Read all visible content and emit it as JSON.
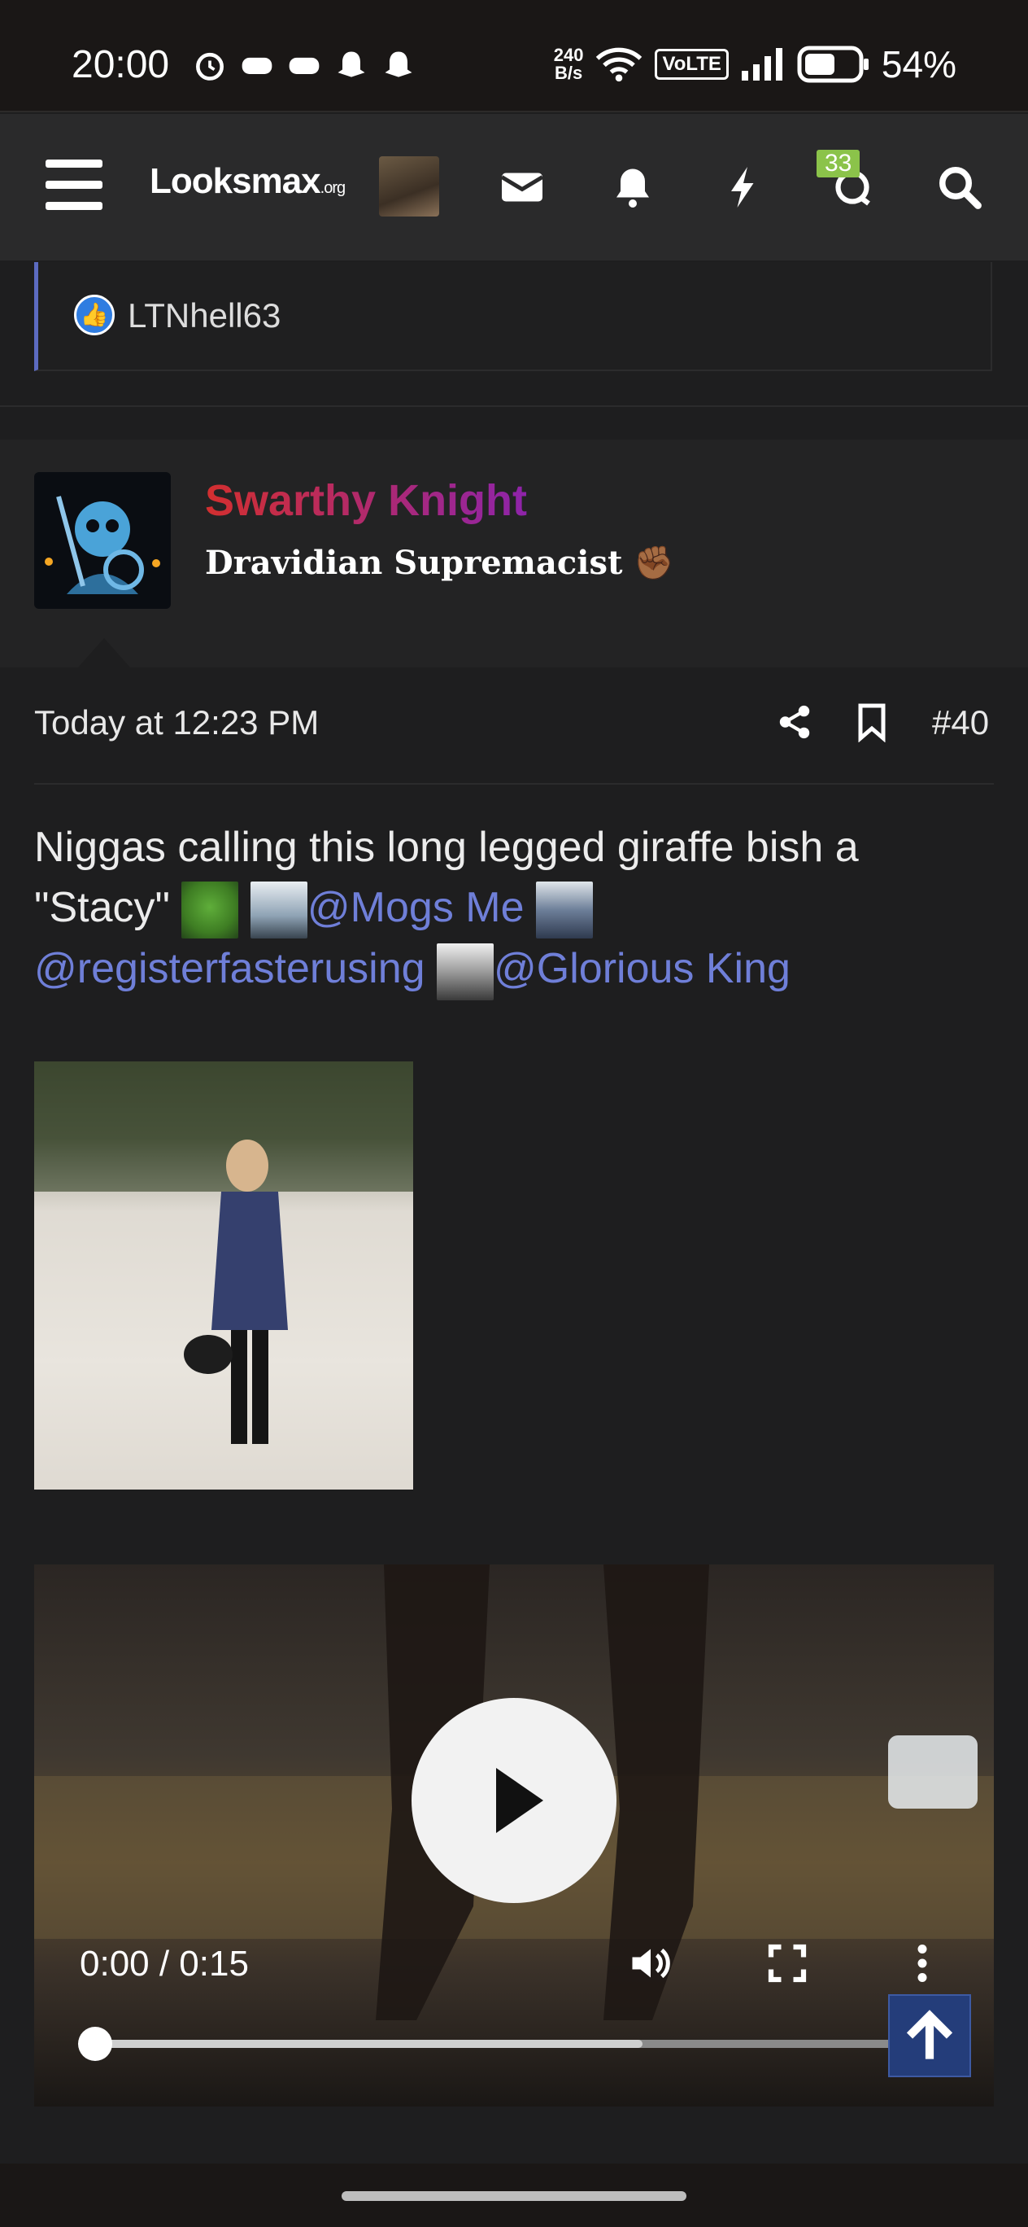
{
  "status_bar": {
    "time": "20:00",
    "speed_value": "240",
    "speed_unit": "B/s",
    "volte": "VoLTE",
    "battery": "54%"
  },
  "header": {
    "logo_main": "Looksmax",
    "logo_suffix": ".org",
    "notifications_badge": "33",
    "icons": [
      "menu-icon",
      "envelope-icon",
      "bell-icon",
      "bolt-icon",
      "chat-icon",
      "search-icon"
    ]
  },
  "reactions": {
    "user": "LTNhell63"
  },
  "post": {
    "username": "Swarthy Knight",
    "user_title": "Dravidian Supremacist ✊🏾",
    "timestamp": "Today at 12:23 PM",
    "post_number": "#40",
    "body_text_1": "Niggas calling this long legged giraffe bish a \"Stacy\"",
    "mention_1": "@Mogs Me",
    "mention_2": "@registerfasterusing",
    "mention_3": "@Glorious King"
  },
  "video": {
    "time_display": "0:00 / 0:15",
    "progress": 0.0,
    "buffered": 0.65
  },
  "colors": {
    "accent": "#6f7fd8",
    "username_start": "#d32f2f",
    "username_end": "#8e24aa",
    "badge": "#8bc34a"
  }
}
